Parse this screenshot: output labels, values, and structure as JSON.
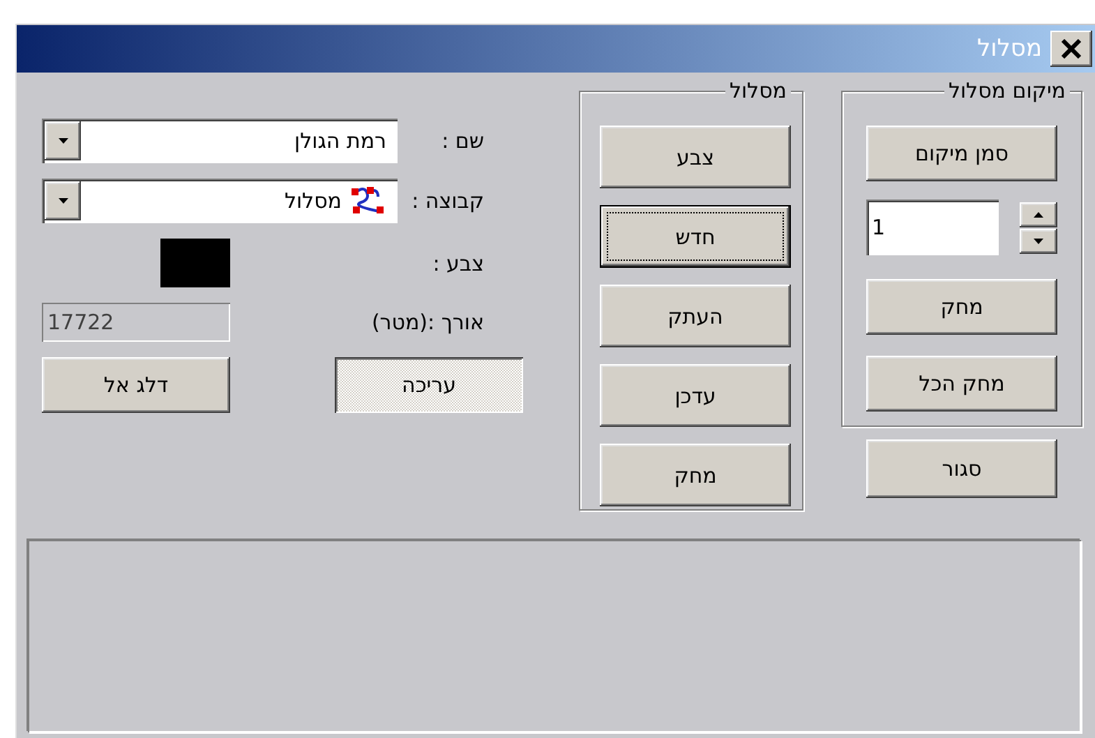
{
  "window": {
    "title": "מסלול"
  },
  "fields": {
    "name": {
      "label": "שם :",
      "value": "רמת הגולן"
    },
    "group": {
      "label": "קבוצה :",
      "value": "מסלול"
    },
    "color": {
      "label": "צבע :",
      "color": "#000000"
    },
    "length": {
      "label": "אורך :(מטר)",
      "value": "17722"
    }
  },
  "edit_button": {
    "label": "עריכה",
    "pressed": true
  },
  "jump_button": {
    "label": "דלג אל"
  },
  "route_group": {
    "title": "מסלול",
    "buttons": [
      {
        "label": "צבע",
        "default": false
      },
      {
        "label": "חדש",
        "default": true
      },
      {
        "label": "העתק",
        "default": false
      },
      {
        "label": "עדכן",
        "default": false
      },
      {
        "label": "מחק",
        "default": false
      }
    ]
  },
  "location_group": {
    "title": "מיקום מסלול",
    "mark_button": "סמן מיקום",
    "index": "1",
    "delete_button": "מחק",
    "delete_all_button": "מחק הכל"
  },
  "close_button": "סגור"
}
